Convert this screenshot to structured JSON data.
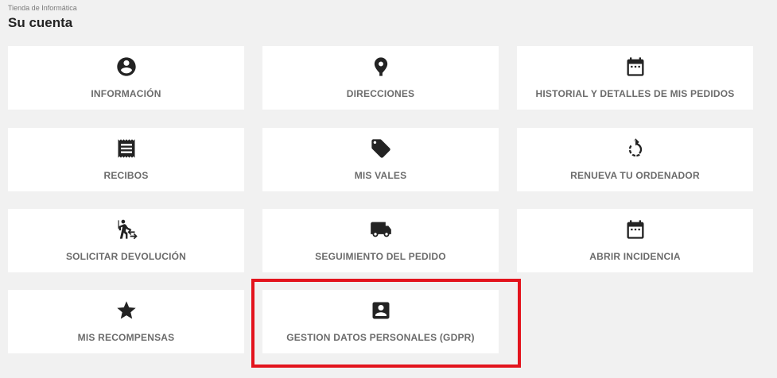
{
  "breadcrumb": "Tienda de Informática",
  "page_title": "Su cuenta",
  "cards": [
    {
      "label": "INFORMACIÓN",
      "icon": "account-circle-icon"
    },
    {
      "label": "DIRECCIONES",
      "icon": "location-pin-icon"
    },
    {
      "label": "HISTORIAL Y DETALLES DE MIS PEDIDOS",
      "icon": "calendar-icon"
    },
    {
      "label": "RECIBOS",
      "icon": "receipt-icon"
    },
    {
      "label": "MIS VALES",
      "icon": "tag-icon"
    },
    {
      "label": "RENUEVA TU ORDENADOR",
      "icon": "renew-icon"
    },
    {
      "label": "SOLICITAR DEVOLUCIÓN",
      "icon": "return-walk-icon"
    },
    {
      "label": "SEGUIMIENTO DEL PEDIDO",
      "icon": "truck-icon"
    },
    {
      "label": "ABRIR INCIDENCIA",
      "icon": "calendar-icon"
    },
    {
      "label": "MIS RECOMPENSAS",
      "icon": "star-icon"
    },
    {
      "label": "GESTION DATOS PERSONALES (GDPR)",
      "icon": "contact-box-icon"
    }
  ],
  "highlight_color": "#e3141d"
}
